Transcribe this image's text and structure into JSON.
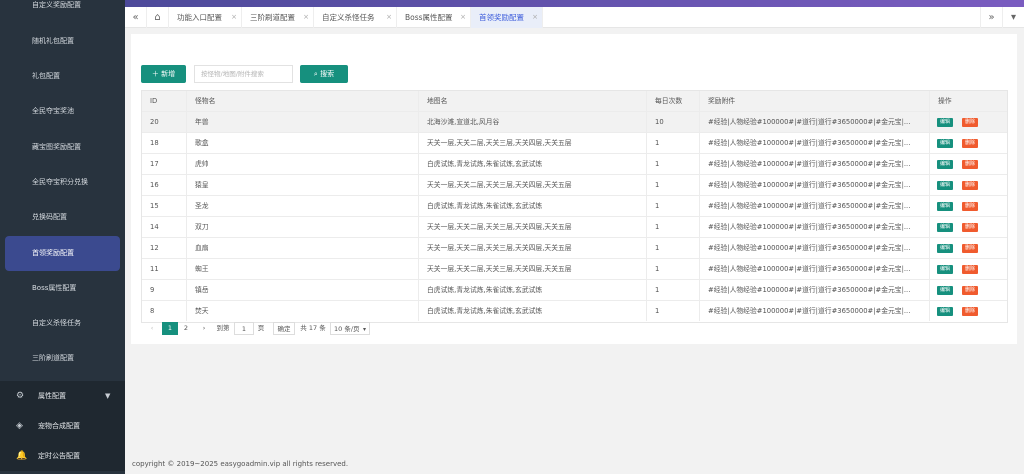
{
  "sidebar": {
    "items": [
      {
        "label": "自定义奖励配置"
      },
      {
        "label": "随机礼包配置"
      },
      {
        "label": "礼包配置"
      },
      {
        "label": "全民夺宝奖池"
      },
      {
        "label": "藏宝图奖励配置"
      },
      {
        "label": "全民夺宝积分兑换"
      },
      {
        "label": "兑换码配置"
      },
      {
        "label": "首领奖励配置"
      },
      {
        "label": "Boss属性配置"
      },
      {
        "label": "自定义杀怪任务"
      },
      {
        "label": "三阶刷道配置"
      }
    ],
    "groups": [
      {
        "label": "属性配置",
        "icon": "⚙"
      },
      {
        "label": "宠物合成配置",
        "icon": "◈"
      },
      {
        "label": "定时公告配置",
        "icon": "🔔"
      }
    ]
  },
  "tabs": {
    "prev_icon": "«",
    "home_icon": "⌂",
    "next_icon": "»",
    "menu_icon": "▾",
    "items": [
      {
        "label": "功能入口配置"
      },
      {
        "label": "三阶刷道配置"
      },
      {
        "label": "自定义杀怪任务"
      },
      {
        "label": "Boss属性配置"
      },
      {
        "label": "首领奖励配置"
      }
    ],
    "close_glyph": "×"
  },
  "toolbar": {
    "add_label": "新增",
    "search_placeholder": "按怪物/地图/附件搜索",
    "search_label": "搜索"
  },
  "table": {
    "headers": {
      "id": "ID",
      "name": "怪物名",
      "map": "地图名",
      "count": "每日次数",
      "attachment": "奖励附件",
      "ops": "操作"
    },
    "edit_label": "编辑",
    "delete_label": "删除",
    "rows": [
      {
        "id": "20",
        "name": "年兽",
        "map": "北海沙滩,宣道北,风月谷",
        "count": "10",
        "attachment": "#经验|人物经验#100000#|#道行|道行#3650000#|#金元宝|..."
      },
      {
        "id": "18",
        "name": "歌盒",
        "map": "天关一层,天关二层,天关三层,天关四层,天关五层",
        "count": "1",
        "attachment": "#经验|人物经验#100000#|#道行|道行#3650000#|#金元宝|..."
      },
      {
        "id": "17",
        "name": "虎帅",
        "map": "白虎试炼,青龙试炼,朱雀试炼,玄武试炼",
        "count": "1",
        "attachment": "#经验|人物经验#100000#|#道行|道行#3650000#|#金元宝|..."
      },
      {
        "id": "16",
        "name": "猿皇",
        "map": "天关一层,天关二层,天关三层,天关四层,天关五层",
        "count": "1",
        "attachment": "#经验|人物经验#100000#|#道行|道行#3650000#|#金元宝|..."
      },
      {
        "id": "15",
        "name": "圣龙",
        "map": "白虎试炼,青龙试炼,朱雀试炼,玄武试炼",
        "count": "1",
        "attachment": "#经验|人物经验#100000#|#道行|道行#3650000#|#金元宝|..."
      },
      {
        "id": "14",
        "name": "双刀",
        "map": "天关一层,天关二层,天关三层,天关四层,天关五层",
        "count": "1",
        "attachment": "#经验|人物经验#100000#|#道行|道行#3650000#|#金元宝|..."
      },
      {
        "id": "12",
        "name": "血扇",
        "map": "天关一层,天关二层,天关三层,天关四层,天关五层",
        "count": "1",
        "attachment": "#经验|人物经验#100000#|#道行|道行#3650000#|#金元宝|..."
      },
      {
        "id": "11",
        "name": "蜘王",
        "map": "天关一层,天关二层,天关三层,天关四层,天关五层",
        "count": "1",
        "attachment": "#经验|人物经验#100000#|#道行|道行#3650000#|#金元宝|..."
      },
      {
        "id": "9",
        "name": "镇岳",
        "map": "白虎试炼,青龙试炼,朱雀试炼,玄武试炼",
        "count": "1",
        "attachment": "#经验|人物经验#100000#|#道行|道行#3650000#|#金元宝|..."
      },
      {
        "id": "8",
        "name": "焚天",
        "map": "白虎试炼,青龙试炼,朱雀试炼,玄武试炼",
        "count": "1",
        "attachment": "#经验|人物经验#100000#|#道行|道行#3650000#|#金元宝|..."
      }
    ]
  },
  "pagination": {
    "prev": "‹",
    "pages": [
      "1",
      "2"
    ],
    "next": "›",
    "goto_label": "到第",
    "goto_value": "1",
    "page_unit": "页",
    "confirm": "确定",
    "total": "共 17 条",
    "page_size": "10 条/页"
  },
  "footer": {
    "text": "copyright © 2019~2025 easygoadmin.vip all rights reserved."
  },
  "colors": {
    "sidebar": "#28333e",
    "active": "#3b4a8f",
    "primary": "#16907e",
    "danger": "#f05b2e"
  }
}
